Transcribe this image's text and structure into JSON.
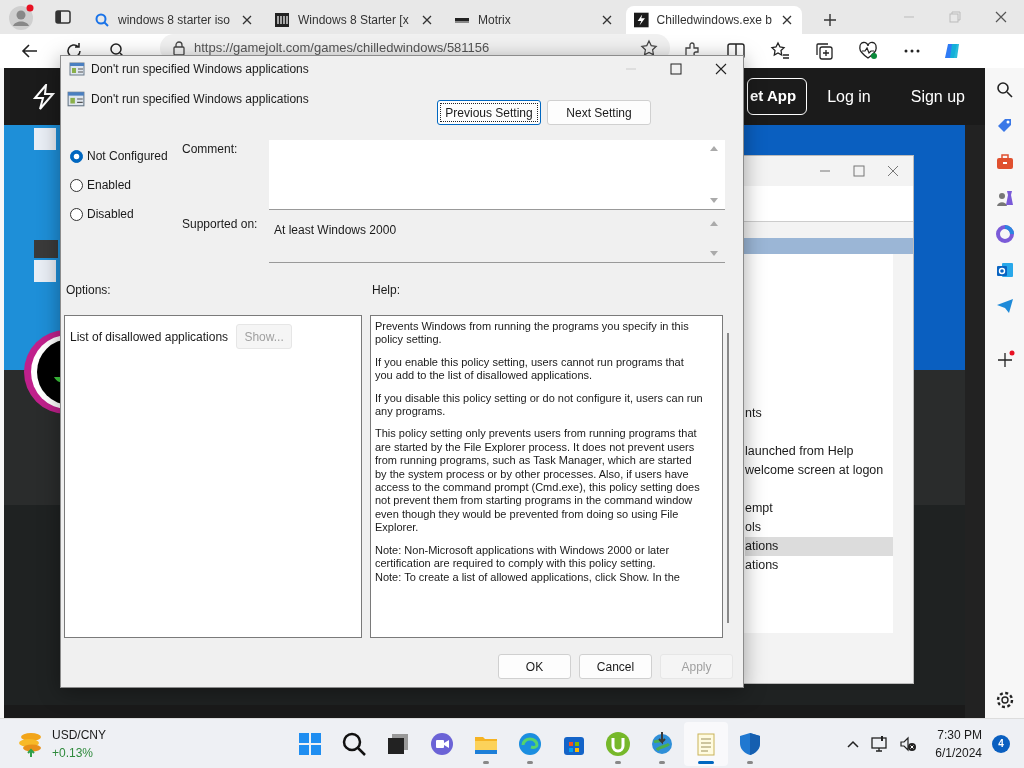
{
  "browser": {
    "tabs": [
      {
        "label": "windows 8 starter iso",
        "selected": false
      },
      {
        "label": "Windows 8 Starter [x",
        "selected": false
      },
      {
        "label": "Motrix",
        "selected": false
      },
      {
        "label": "Chilledwindows.exe b",
        "selected": true
      }
    ],
    "address": "https://gamejolt.com/games/chilledwindows/581156"
  },
  "site": {
    "get_app": "et App",
    "links": [
      "Log in",
      "Sign up"
    ]
  },
  "background_window": {
    "items": [
      {
        "label": "nts",
        "selected": false
      },
      {
        "label": "launched from Help",
        "selected": false
      },
      {
        "label": "welcome screen at logon",
        "selected": false
      },
      {
        "label": "empt",
        "selected": false
      },
      {
        "label": "ols",
        "selected": false
      },
      {
        "label": "ations",
        "selected": true
      },
      {
        "label": "ations",
        "selected": false
      }
    ]
  },
  "dialog": {
    "title": "Don't run specified Windows applications",
    "policy_name": "Don't run specified Windows applications",
    "nav_buttons": [
      {
        "label": "Previous Setting",
        "focused": true
      },
      {
        "label": "Next Setting",
        "focused": false
      }
    ],
    "states": [
      {
        "label": "Not Configured",
        "selected": true
      },
      {
        "label": "Enabled",
        "selected": false
      },
      {
        "label": "Disabled",
        "selected": false
      }
    ],
    "comment_label": "Comment:",
    "supported_label": "Supported on:",
    "supported_value": "At least Windows 2000",
    "options_label": "Options:",
    "help_label": "Help:",
    "options": [
      {
        "label": "List of disallowed applications",
        "button": "Show...",
        "disabled": true
      }
    ],
    "help": [
      "Prevents Windows from running the programs you specify in this policy setting.",
      "If you enable this policy setting, users cannot run programs that you add to the list of disallowed applications.",
      "If you disable this policy setting or do not configure it, users can run any programs.",
      "This policy setting only prevents users from running programs that are started by the File Explorer process. It does not prevent users from running programs, such as Task Manager, which are started by the system process or by other processes.  Also, if users have access to the command prompt (Cmd.exe), this policy setting does not prevent them from starting programs in the command window even though they would be prevented from doing so using File Explorer.",
      "Note: Non-Microsoft applications with Windows 2000 or later certification are required to comply with this policy setting.\nNote: To create a list of allowed applications, click Show.  In the"
    ],
    "buttons": [
      {
        "label": "OK",
        "disabled": false
      },
      {
        "label": "Cancel",
        "disabled": false
      },
      {
        "label": "Apply",
        "disabled": true
      }
    ]
  },
  "taskbar": {
    "widget": {
      "title": "USD/CNY",
      "change": "+0.13%"
    },
    "apps": [
      {
        "running": false,
        "selected": false
      },
      {
        "running": false,
        "selected": false
      },
      {
        "running": false,
        "selected": false
      },
      {
        "running": false,
        "selected": false
      },
      {
        "running": true,
        "selected": false
      },
      {
        "running": true,
        "selected": false
      },
      {
        "running": false,
        "selected": false
      },
      {
        "running": true,
        "selected": false
      },
      {
        "running": true,
        "selected": false
      },
      {
        "running": true,
        "selected": true
      },
      {
        "running": true,
        "selected": false
      }
    ],
    "time": "7:30 PM",
    "date": "6/1/2024",
    "notifications": "4"
  }
}
